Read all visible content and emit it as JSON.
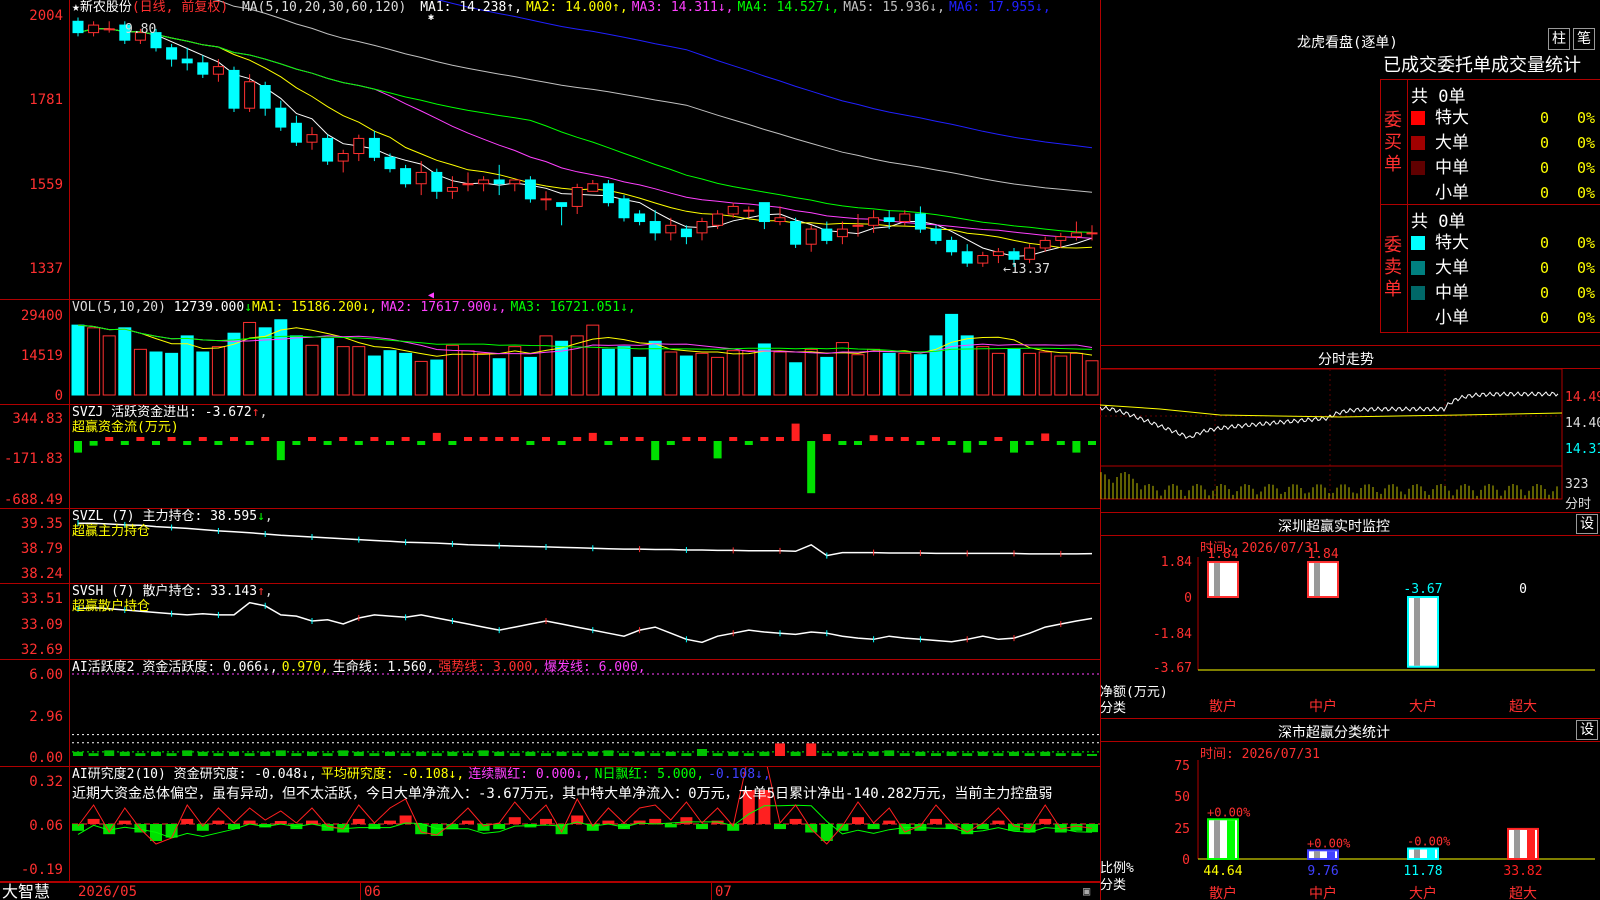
{
  "stock": {
    "name": "新农股份",
    "star": "★",
    "period": "(日线, 前复权)"
  },
  "kline": {
    "ma_label": "MA(5,10,20,30,60,120)",
    "ma_values": [
      {
        "text": "MA1: 14.238",
        "arrow": "↑",
        "color": "#ffffff"
      },
      {
        "text": "MA2: 14.000",
        "arrow": "↑",
        "color": "#ffff00"
      },
      {
        "text": "MA3: 14.311",
        "arrow": "↓",
        "color": "#ff40ff"
      },
      {
        "text": "MA4: 14.527",
        "arrow": "↓",
        "color": "#00ff00"
      },
      {
        "text": "MA5: 15.936",
        "arrow": "↓",
        "color": "#c0c0c0"
      },
      {
        "text": "MA6: 17.955",
        "arrow": "↓",
        "color": "#2020ff"
      }
    ],
    "y_ticks": [
      "2004",
      "1781",
      "1559",
      "1337"
    ],
    "high_label": "9.80",
    "low_label": "←13.37"
  },
  "volume": {
    "label": "VOL(5,10,20)",
    "value": "12739.000",
    "mas": [
      {
        "text": "MA1: 15186.200",
        "arrow": "↓",
        "color": "#ffff00"
      },
      {
        "text": "MA2: 17617.900",
        "arrow": "↓",
        "color": "#ff40ff"
      },
      {
        "text": "MA3: 16721.051",
        "arrow": "↓",
        "color": "#00ff00"
      }
    ],
    "y_ticks": [
      "29400",
      "14519",
      "0"
    ]
  },
  "svzj": {
    "title": "SVZJ  活跃资金进出: -3.672",
    "arrow": "↑",
    "sub": "超赢资金流(万元)",
    "y_ticks": [
      "344.83",
      "-171.83",
      "-688.49"
    ]
  },
  "svzl": {
    "title": "SVZL (7) 主力持仓: 38.595",
    "arrow": "↓",
    "sub": "超赢主力持仓",
    "y_ticks": [
      "39.35",
      "38.79",
      "38.24"
    ]
  },
  "svsh": {
    "title": "SVSH (7) 散户持仓: 33.143",
    "arrow": "↑",
    "sub": "超赢散户持仓",
    "y_ticks": [
      "33.51",
      "33.09",
      "32.69"
    ]
  },
  "ai_active": {
    "title": "AI活跃度2",
    "items": [
      {
        "text": "资金活跃度: 0.066",
        "arrow": "↓",
        "color": "#ffffff"
      },
      {
        "text": "0.970",
        "arrow": "",
        "color": "#ffff00"
      },
      {
        "text": "生命线: 1.560",
        "arrow": "",
        "color": "#ffffff"
      },
      {
        "text": "强势线: 3.000",
        "arrow": "",
        "color": "#ff3030"
      },
      {
        "text": "爆发线: 6.000",
        "arrow": "",
        "color": "#ff40ff"
      }
    ],
    "y_ticks": [
      "6.00",
      "2.96",
      "0.00"
    ]
  },
  "ai_research": {
    "title": "AI研究度2(10)",
    "items": [
      {
        "text": "资金研究度: -0.048",
        "arrow": "↓",
        "color": "#ffffff"
      },
      {
        "text": "平均研究度: -0.108",
        "arrow": "↓",
        "color": "#ffff00"
      },
      {
        "text": "连续飘红: 0.000",
        "arrow": "↓",
        "color": "#ff40ff"
      },
      {
        "text": "N日飘红: 5.000",
        "arrow": "",
        "color": "#00ff00"
      },
      {
        "text": "-0.108",
        "arrow": "↓",
        "color": "#4040ff"
      }
    ],
    "comment": "近期大资金总体偏空，虽有异动，但不太活跃，今日大单净流入：-3.67万元，其中特大单净流入：0万元，大单5日累计净出-140.282万元，当前主力控盘弱",
    "y_ticks": [
      "0.32",
      "0.06",
      "-0.19"
    ]
  },
  "timeline": {
    "brand": "大智慧",
    "dates": [
      "2026/05",
      "06",
      "07"
    ]
  },
  "longhu": {
    "title": "龙虎看盘(逐单)",
    "btn1": "柱",
    "btn2": "笔",
    "header": "已成交委托单成交量统计",
    "buy": {
      "side": "委买单",
      "total": "共 0单",
      "rows": [
        {
          "label": "特大",
          "count": "0",
          "pct": "0%",
          "color": "#ff0000"
        },
        {
          "label": "大单",
          "count": "0",
          "pct": "0%",
          "color": "#a00000"
        },
        {
          "label": "中单",
          "count": "0",
          "pct": "0%",
          "color": "#600000"
        },
        {
          "label": "小单",
          "count": "0",
          "pct": "0%",
          "color": ""
        }
      ]
    },
    "sell": {
      "side": "委卖单",
      "total": "共 0单",
      "rows": [
        {
          "label": "特大",
          "count": "0",
          "pct": "0%",
          "color": "#00ffff"
        },
        {
          "label": "大单",
          "count": "0",
          "pct": "0%",
          "color": "#008080"
        },
        {
          "label": "中单",
          "count": "0",
          "pct": "0%",
          "color": "#006868"
        },
        {
          "label": "小单",
          "count": "0",
          "pct": "0%",
          "color": ""
        }
      ]
    }
  },
  "fenshi": {
    "title": "分时走势",
    "y_ticks": [
      "14.49",
      "14.40",
      "14.31"
    ],
    "vol_label": "323",
    "unit": "分时"
  },
  "monitor": {
    "title": "深圳超赢实时监控",
    "btn": "设",
    "time": "时间: 2026/07/31",
    "y_ticks": [
      "1.84",
      "0",
      "-1.84",
      "-3.67"
    ],
    "axis_label": "净额(万元)",
    "cat_label": "分类",
    "bars": [
      {
        "cat": "散户",
        "value": 1.84,
        "label": "1.84",
        "color": "#ff3030"
      },
      {
        "cat": "中户",
        "value": 1.84,
        "label": "1.84",
        "color": "#ff3030"
      },
      {
        "cat": "大户",
        "value": -3.67,
        "label": "-3.67",
        "color": "#00ffff"
      },
      {
        "cat": "超大",
        "value": 0,
        "label": "0",
        "color": "#ffffff"
      }
    ]
  },
  "classify": {
    "title": "深市超赢分类统计",
    "btn": "设",
    "time": "时间: 2026/07/31",
    "y_ticks": [
      "75",
      "50",
      "25",
      "0"
    ],
    "axis_label": "比例%",
    "cat_label": "分类",
    "bars": [
      {
        "cat": "散户",
        "value": 44.64,
        "label": "44.64",
        "change": "+0.00%",
        "color": "#00ff00"
      },
      {
        "cat": "中户",
        "value": 9.76,
        "label": "9.76",
        "change": "+0.00%",
        "color": "#4040ff"
      },
      {
        "cat": "大户",
        "value": 11.78,
        "label": "11.78",
        "change": "-0.00%",
        "color": "#00ffff"
      },
      {
        "cat": "超大",
        "value": 33.82,
        "label": "33.82",
        "change": "",
        "color": "#ff2020"
      }
    ]
  },
  "chart_data": [
    {
      "type": "candlestick",
      "title": "新农股份",
      "y_ticks": [
        20.04,
        17.81,
        15.59,
        13.37
      ],
      "high": 19.8,
      "low": 13.37,
      "ohlc": [
        [
          19.9,
          19.6,
          20.0,
          19.5
        ],
        [
          19.6,
          19.8,
          19.9,
          19.5
        ],
        [
          19.7,
          19.7,
          19.9,
          19.6
        ],
        [
          19.8,
          19.4,
          19.9,
          19.3
        ],
        [
          19.4,
          19.6,
          19.7,
          19.3
        ],
        [
          19.6,
          19.2,
          19.7,
          19.1
        ],
        [
          19.2,
          18.9,
          19.3,
          18.7
        ],
        [
          18.9,
          18.8,
          19.2,
          18.6
        ],
        [
          18.8,
          18.5,
          19.0,
          18.4
        ],
        [
          18.5,
          18.7,
          18.9,
          18.3
        ],
        [
          18.6,
          17.6,
          18.7,
          17.5
        ],
        [
          17.6,
          18.3,
          18.5,
          17.5
        ],
        [
          18.2,
          17.6,
          18.3,
          17.4
        ],
        [
          17.6,
          17.1,
          17.8,
          17.0
        ],
        [
          17.2,
          16.7,
          17.4,
          16.6
        ],
        [
          16.7,
          16.9,
          17.1,
          16.5
        ],
        [
          16.8,
          16.2,
          16.9,
          16.1
        ],
        [
          16.2,
          16.4,
          16.5,
          15.9
        ],
        [
          16.4,
          16.8,
          16.9,
          16.2
        ],
        [
          16.8,
          16.3,
          17.0,
          16.2
        ],
        [
          16.3,
          16.0,
          16.4,
          15.9
        ],
        [
          16.0,
          15.6,
          16.1,
          15.5
        ],
        [
          15.6,
          15.9,
          16.2,
          15.3
        ],
        [
          15.9,
          15.4,
          16.0,
          15.2
        ],
        [
          15.4,
          15.5,
          15.8,
          15.2
        ],
        [
          15.6,
          15.6,
          15.9,
          15.4
        ],
        [
          15.6,
          15.7,
          15.8,
          15.4
        ],
        [
          15.7,
          15.6,
          16.1,
          15.3
        ],
        [
          15.6,
          15.7,
          15.7,
          15.4
        ],
        [
          15.7,
          15.2,
          15.8,
          15.1
        ],
        [
          15.2,
          15.2,
          15.4,
          14.9
        ],
        [
          15.1,
          15.0,
          15.1,
          14.5
        ],
        [
          15.0,
          15.5,
          15.6,
          14.8
        ],
        [
          15.4,
          15.6,
          15.7,
          15.4
        ],
        [
          15.6,
          15.1,
          15.7,
          15.0
        ],
        [
          15.2,
          14.7,
          15.3,
          14.6
        ],
        [
          14.8,
          14.6,
          14.9,
          14.5
        ],
        [
          14.6,
          14.3,
          14.9,
          14.1
        ],
        [
          14.3,
          14.5,
          14.7,
          14.1
        ],
        [
          14.4,
          14.2,
          14.5,
          14.0
        ],
        [
          14.3,
          14.6,
          14.7,
          14.1
        ],
        [
          14.5,
          14.8,
          14.9,
          14.4
        ],
        [
          14.8,
          15.0,
          15.1,
          14.7
        ],
        [
          14.9,
          14.9,
          15.0,
          14.7
        ],
        [
          15.1,
          14.6,
          15.1,
          14.4
        ],
        [
          14.6,
          14.7,
          15.0,
          14.5
        ],
        [
          14.6,
          14.0,
          14.7,
          13.9
        ],
        [
          14.0,
          14.4,
          14.5,
          13.8
        ],
        [
          14.4,
          14.1,
          14.6,
          14.0
        ],
        [
          14.2,
          14.4,
          14.6,
          14.0
        ],
        [
          14.5,
          14.5,
          14.8,
          14.2
        ],
        [
          14.5,
          14.7,
          14.9,
          14.3
        ],
        [
          14.7,
          14.6,
          14.9,
          14.4
        ],
        [
          14.6,
          14.8,
          14.9,
          14.5
        ],
        [
          14.8,
          14.4,
          15.0,
          14.3
        ],
        [
          14.4,
          14.1,
          14.5,
          14.0
        ],
        [
          14.1,
          13.8,
          14.2,
          13.7
        ],
        [
          13.8,
          13.5,
          14.0,
          13.4
        ],
        [
          13.5,
          13.7,
          13.8,
          13.4
        ],
        [
          13.7,
          13.8,
          13.9,
          13.5
        ],
        [
          13.8,
          13.6,
          13.9,
          13.4
        ],
        [
          13.6,
          13.9,
          14.0,
          13.5
        ],
        [
          13.9,
          14.1,
          14.2,
          13.8
        ],
        [
          14.1,
          14.2,
          14.3,
          13.9
        ],
        [
          14.2,
          14.3,
          14.6,
          14.1
        ],
        [
          14.3,
          14.3,
          14.5,
          14.1
        ]
      ]
    },
    {
      "type": "bar",
      "title": "VOL(5,10,20)",
      "y_ticks": [
        29400,
        14519,
        0
      ],
      "values": [
        26000,
        25000,
        22000,
        25000,
        17000,
        16000,
        15500,
        22000,
        16000,
        18000,
        23000,
        27000,
        25000,
        28000,
        22000,
        18500,
        21000,
        18000,
        18000,
        14500,
        16500,
        15500,
        12500,
        13000,
        18500,
        16500,
        15500,
        13500,
        18000,
        14000,
        22000,
        20000,
        22000,
        26000,
        17000,
        18000,
        14000,
        20000,
        16000,
        14500,
        15500,
        14000,
        16500,
        16500,
        19000,
        16000,
        12000,
        17000,
        14000,
        19500,
        15000,
        17000,
        15500,
        15500,
        15000,
        22000,
        30000,
        22000,
        18000,
        15500,
        17000,
        15500,
        16000,
        14500,
        15500,
        12739
      ]
    },
    {
      "type": "bar",
      "title": "超赢资金流(万元)",
      "y_ticks": [
        344.83,
        -171.83,
        -688.49
      ],
      "values": [
        -200,
        -80,
        30,
        -40,
        30,
        -40,
        30,
        -60,
        20,
        -40,
        30,
        -40,
        30,
        -330,
        -30,
        30,
        -20,
        30,
        -40,
        30,
        -40,
        30,
        -30,
        140,
        -40,
        30,
        20,
        30,
        40,
        -60,
        30,
        -20,
        30,
        140,
        -40,
        30,
        30,
        -330,
        -30,
        30,
        20,
        -300,
        30,
        -30,
        60,
        30,
        300,
        -900,
        120,
        -30,
        -20,
        100,
        30,
        30,
        -30,
        20,
        -30,
        -200,
        -40,
        30,
        -200,
        -30,
        130,
        -40,
        -200,
        -10
      ]
    },
    {
      "type": "line",
      "title": "超赢主力持仓",
      "y_ticks": [
        39.35,
        38.79,
        38.24
      ],
      "values": [
        39.3,
        39.3,
        39.28,
        39.26,
        39.25,
        39.22,
        39.2,
        39.18,
        39.15,
        39.12,
        39.1,
        39.08,
        39.05,
        39.02,
        39.0,
        38.98,
        38.96,
        38.94,
        38.92,
        38.9,
        38.88,
        38.86,
        38.85,
        38.84,
        38.82,
        38.8,
        38.79,
        38.78,
        38.77,
        38.76,
        38.75,
        38.74,
        38.73,
        38.72,
        38.71,
        38.7,
        38.7,
        38.69,
        38.69,
        38.68,
        38.68,
        38.67,
        38.67,
        38.66,
        38.66,
        38.66,
        38.65,
        38.8,
        38.55,
        38.62,
        38.62,
        38.62,
        38.61,
        38.61,
        38.61,
        38.6,
        38.6,
        38.6,
        38.6,
        38.6,
        38.6,
        38.59,
        38.59,
        38.59,
        38.59,
        38.595
      ]
    },
    {
      "type": "line",
      "title": "超赢散户持仓",
      "y_ticks": [
        33.51,
        33.09,
        32.69
      ],
      "values": [
        33.3,
        33.32,
        33.3,
        33.28,
        33.26,
        33.24,
        33.22,
        33.2,
        33.22,
        33.2,
        33.2,
        33.4,
        33.35,
        33.2,
        33.18,
        33.1,
        33.12,
        33.05,
        33.15,
        33.2,
        33.18,
        33.16,
        33.2,
        33.15,
        33.1,
        33.05,
        33.0,
        32.95,
        33.0,
        33.05,
        33.1,
        33.05,
        33.0,
        32.95,
        32.9,
        32.85,
        32.95,
        33.0,
        32.9,
        32.8,
        32.75,
        32.85,
        32.9,
        32.95,
        32.92,
        32.9,
        32.88,
        32.92,
        32.9,
        32.85,
        32.82,
        32.8,
        32.85,
        32.82,
        32.8,
        32.78,
        32.76,
        32.8,
        32.85,
        32.8,
        32.82,
        32.9,
        33.0,
        33.05,
        33.1,
        33.143
      ]
    },
    {
      "type": "bar",
      "title": "AI活跃度2",
      "y_ticks": [
        6.0,
        2.96,
        0.0
      ],
      "values": [
        0.3,
        0.2,
        0.4,
        0.3,
        0.2,
        0.3,
        0.2,
        0.4,
        0.3,
        0.2,
        0.3,
        0.2,
        0.3,
        0.4,
        0.2,
        0.3,
        0.2,
        0.4,
        0.3,
        0.2,
        0.3,
        0.2,
        0.3,
        0.2,
        0.3,
        0.2,
        0.4,
        0.3,
        0.2,
        0.3,
        0.2,
        0.3,
        0.2,
        0.3,
        0.4,
        0.2,
        0.3,
        0.2,
        0.3,
        0.2,
        0.5,
        0.2,
        0.3,
        0.2,
        0.3,
        0.9,
        0.3,
        0.9,
        0.2,
        0.3,
        0.2,
        0.3,
        0.4,
        0.2,
        0.3,
        0.2,
        0.3,
        0.2,
        0.3,
        0.2,
        0.3,
        0.2,
        0.3,
        0.2,
        0.2,
        0.066
      ]
    },
    {
      "type": "bar",
      "title": "AI研究度2(10)",
      "y_ticks": [
        0.32,
        0.06,
        -0.19
      ],
      "values": [
        -0.04,
        0.03,
        -0.06,
        0.02,
        -0.05,
        -0.1,
        -0.08,
        0.03,
        -0.04,
        0.02,
        -0.03,
        0.02,
        -0.02,
        0.01,
        -0.03,
        0.02,
        -0.04,
        -0.05,
        0.03,
        -0.03,
        0.02,
        0.05,
        -0.06,
        -0.07,
        -0.03,
        0.02,
        -0.04,
        -0.03,
        0.04,
        -0.02,
        0.03,
        -0.06,
        0.05,
        -0.04,
        0.02,
        -0.03,
        0.02,
        0.03,
        -0.02,
        0.04,
        -0.03,
        0.02,
        -0.04,
        0.2,
        0.2,
        -0.03,
        0.03,
        -0.05,
        -0.1,
        -0.04,
        0.04,
        -0.03,
        0.02,
        -0.06,
        -0.04,
        0.03,
        -0.03,
        -0.06,
        -0.03,
        0.02,
        -0.04,
        -0.05,
        0.03,
        -0.05,
        -0.04,
        -0.048
      ]
    }
  ]
}
